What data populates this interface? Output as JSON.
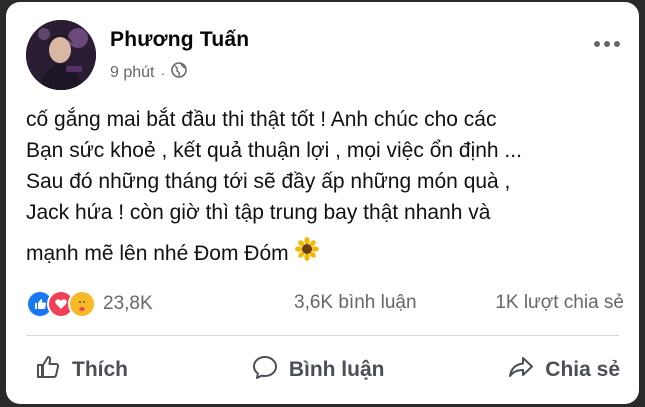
{
  "post": {
    "author": "Phương Tuấn",
    "time": "9 phút",
    "separator": "·",
    "lines": [
      "cố gắng mai bắt đầu thi thật tốt ! Anh chúc cho các",
      "Bạn sức khoẻ , kết quả thuận lợi , mọi việc ổn định ...",
      "Sau đó những tháng tới sẽ đầy ấp những món quà ,",
      "Jack hứa ! còn giờ thì tập trung bay thật nhanh và",
      "mạnh mẽ lên nhé Đom Đóm"
    ],
    "emoji_icon": "sunflower-icon"
  },
  "stats": {
    "reaction_count": "23,8K",
    "comments": "3,6K bình luận",
    "shares": "1K lượt chia sẻ"
  },
  "actions": {
    "like": "Thích",
    "comment": "Bình luận",
    "share": "Chia sẻ"
  },
  "colors": {
    "like_blue": "#1877f2",
    "love_red": "#f33e58",
    "care_yellow": "#f7b928",
    "muted_text": "#65676b"
  }
}
